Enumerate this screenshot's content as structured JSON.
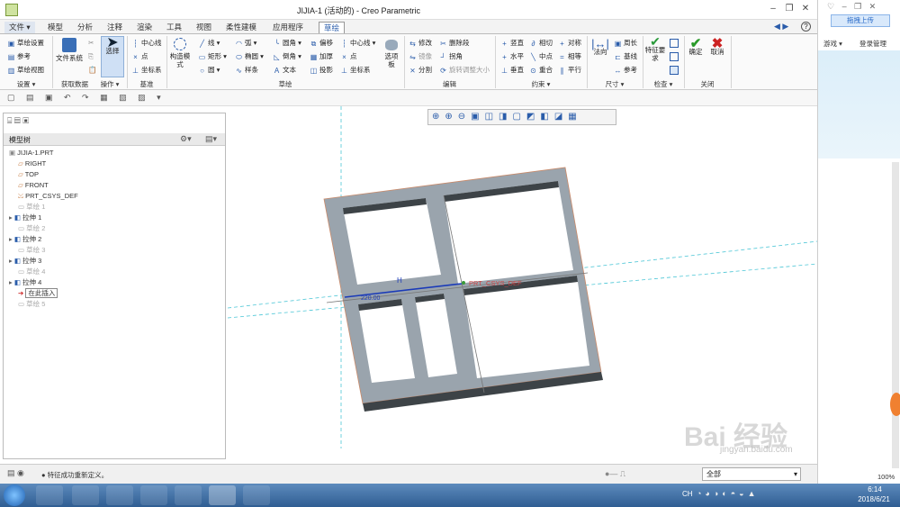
{
  "window": {
    "title": "JIJIA-1 (活动的) - Creo Parametric"
  },
  "menu_tabs": [
    "文件 ▾",
    "模型",
    "分析",
    "注释",
    "渲染",
    "工具",
    "视图",
    "柔性建模",
    "应用程序",
    "草绘"
  ],
  "ribbon": {
    "settings": {
      "items": [
        "草绘设置",
        "参考",
        "草绘视图"
      ],
      "label": "设置 ▾"
    },
    "getdata": {
      "item": "文件系统",
      "label": "获取数据"
    },
    "ops": {
      "item": "选择",
      "label": "操作 ▾"
    },
    "datum": {
      "items": [
        "中心线",
        "点",
        "坐标系"
      ],
      "label": "基准"
    },
    "sketch": {
      "construct": "构造模式",
      "col1": [
        "线 ▾",
        "矩形 ▾",
        "圆 ▾"
      ],
      "col2": [
        "弧 ▾",
        "椭圆 ▾",
        "样条"
      ],
      "col3": [
        "圆角 ▾",
        "倒角 ▾",
        "文本"
      ],
      "col4": [
        "偏移",
        "加厚",
        "投影"
      ],
      "col5": [
        "中心线 ▾",
        "点",
        "坐标系"
      ],
      "palette": "选项板",
      "label": "草绘"
    },
    "edit": {
      "items": [
        "修改",
        "删除段",
        "镜像",
        "拐角",
        "分割",
        "旋转调整大小"
      ],
      "label": "编辑"
    },
    "constraint": {
      "items": [
        "竖直",
        "相切",
        "对称",
        "水平",
        "中点",
        "相等",
        "垂直",
        "重合",
        "平行"
      ],
      "label": "约束 ▾"
    },
    "dimension": {
      "items": [
        "法向",
        "周长",
        "基线",
        "参考"
      ],
      "label": "尺寸 ▾"
    },
    "inspect": {
      "item": "特征要求",
      "label": "检查 ▾"
    },
    "close": {
      "ok": "确定",
      "cancel": "取消",
      "label": "关闭"
    }
  },
  "model_tree": {
    "header": "模型树",
    "items": [
      {
        "label": "JIJIA-1.PRT",
        "dim": false
      },
      {
        "label": "RIGHT",
        "dim": false
      },
      {
        "label": "TOP",
        "dim": false
      },
      {
        "label": "FRONT",
        "dim": false
      },
      {
        "label": "PRT_CSYS_DEF",
        "dim": false
      },
      {
        "label": "草绘 1",
        "dim": true
      },
      {
        "label": "拉伸 1",
        "dim": false
      },
      {
        "label": "草绘 2",
        "dim": true
      },
      {
        "label": "拉伸 2",
        "dim": false
      },
      {
        "label": "草绘 3",
        "dim": true
      },
      {
        "label": "拉伸 3",
        "dim": false
      },
      {
        "label": "草绘 4",
        "dim": true
      },
      {
        "label": "拉伸 4",
        "dim": false
      },
      {
        "label": "在此插入",
        "dim": false
      },
      {
        "label": "草绘 5",
        "dim": true
      }
    ]
  },
  "viewport": {
    "csys_label": "PRT_CSYS_DEF",
    "dim_text": "220.00",
    "h_label": "H"
  },
  "status": {
    "message": "● 特征成功重新定义。",
    "filter": "全部"
  },
  "side_pane": {
    "upload": "拖拽上传",
    "games": "游戏 ▾",
    "login": "登录管理",
    "zoom": "100%"
  },
  "taskbar": {
    "lang": "CH",
    "time": "6:14",
    "date": "2018/6/21"
  },
  "watermark": {
    "text": "Bai 经验",
    "sub": "jingyan.baidu.com"
  },
  "colors": {
    "ribbon_blue": "#2a5caa",
    "frame_top": "#9aa4ad",
    "frame_side": "#3d4347",
    "taskbar": "#2f5d92"
  }
}
